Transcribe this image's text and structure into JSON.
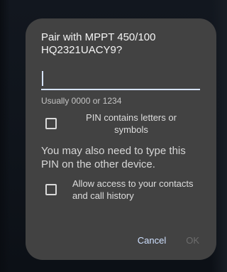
{
  "dialog": {
    "title": "Pair with MPPT 450/100 HQ2321UACY9?",
    "pin_input": {
      "value": "",
      "placeholder": ""
    },
    "hint": "Usually 0000 or 1234",
    "pin_letters_checkbox": {
      "label": "PIN contains letters or symbols",
      "checked": false
    },
    "note": "You may also need to type this PIN on the other device.",
    "contacts_checkbox": {
      "label": "Allow access to your contacts and call history",
      "checked": false
    },
    "buttons": {
      "cancel": "Cancel",
      "ok": "OK"
    }
  },
  "colors": {
    "dialog_background": "#424242",
    "accent": "#d6e3ff",
    "disabled_text": "#6d6d6d"
  }
}
